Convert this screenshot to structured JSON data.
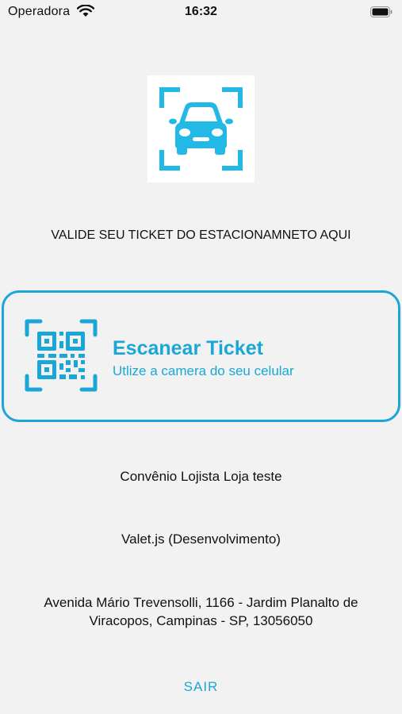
{
  "status_bar": {
    "carrier": "Operadora",
    "time": "16:32"
  },
  "logo": {
    "icon": "car-scan-icon",
    "color": "#23b9e6"
  },
  "headline": "VALIDE SEU TICKET DO ESTACIONAMNETO AQUI",
  "scan_card": {
    "title": "Escanear Ticket",
    "subtitle": "Utlize a camera do seu celular",
    "icon": "qr-code-scan-icon",
    "accent_color": "#1aa7d6"
  },
  "agreement": "Convênio Lojista Loja teste",
  "company": "Valet.js (Desenvolvimento)",
  "address_line1": "Avenida Mário Trevensolli, 1166 - Jardim Planalto de",
  "address_line2": "Viracopos, Campinas - SP, 13056050",
  "logout_label": "SAIR"
}
